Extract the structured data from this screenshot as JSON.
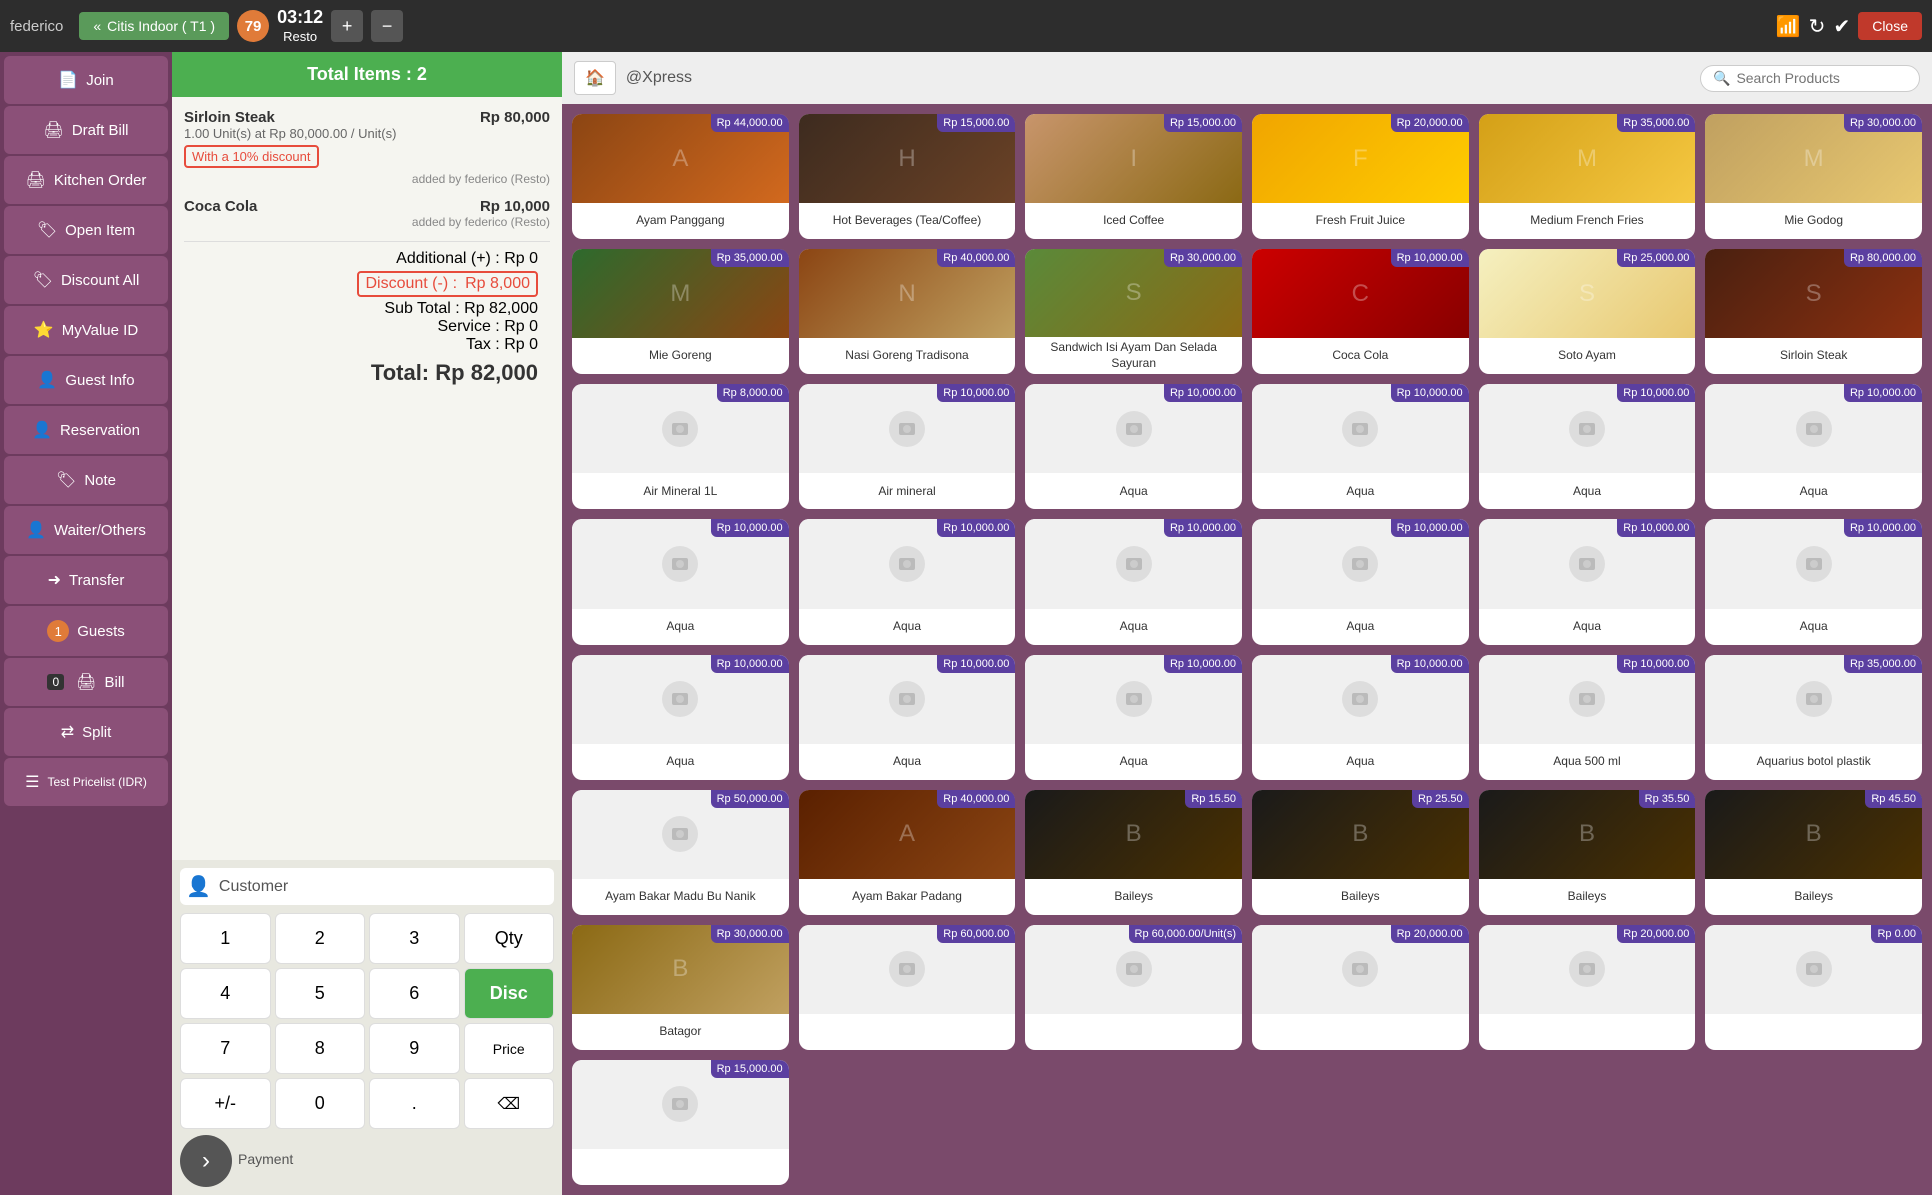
{
  "topbar": {
    "username": "federico",
    "venue": "Citis Indoor ( T1 )",
    "table_number": "79",
    "time": "03:12",
    "time_label": "Resto",
    "add_icon": "+",
    "minus_icon": "−",
    "close_label": "Close"
  },
  "sidebar": {
    "items": [
      {
        "id": "join",
        "label": "Join",
        "icon": "📄"
      },
      {
        "id": "draft-bill",
        "label": "Draft Bill",
        "icon": "🖨"
      },
      {
        "id": "kitchen-order",
        "label": "Kitchen Order",
        "icon": "🖨"
      },
      {
        "id": "open-item",
        "label": "Open Item",
        "icon": "🏷"
      },
      {
        "id": "discount-all",
        "label": "Discount All",
        "icon": "🏷"
      },
      {
        "id": "myvalue-id",
        "label": "MyValue ID",
        "icon": "⭐"
      },
      {
        "id": "guest-info",
        "label": "Guest Info",
        "icon": "👤"
      },
      {
        "id": "reservation",
        "label": "Reservation",
        "icon": "👤"
      },
      {
        "id": "note",
        "label": "Note",
        "icon": "🏷"
      },
      {
        "id": "waiter-others",
        "label": "Waiter/Others",
        "icon": "👤"
      },
      {
        "id": "transfer",
        "label": "Transfer",
        "icon": "➜"
      },
      {
        "id": "guests",
        "label": "Guests",
        "icon": "1"
      },
      {
        "id": "bill",
        "label": "Bill",
        "icon": "🖨",
        "badge": "0"
      },
      {
        "id": "split",
        "label": "Split",
        "icon": "🔀"
      },
      {
        "id": "test-pricelist",
        "label": "Test Pricelist\n(IDR)",
        "icon": "☰"
      }
    ]
  },
  "order": {
    "item1": {
      "name": "Sirloin Steak",
      "price": "Rp 80,000",
      "unit_detail": "1.00 Unit(s) at Rp 80,000.00 / Unit(s)",
      "discount_label": "With a 10% discount",
      "added_by": "added by federico (Resto)"
    },
    "item2": {
      "name": "Coca Cola",
      "price": "Rp 10,000",
      "added_by": "added by federico (Resto)"
    },
    "totals": {
      "additional_label": "Additional (+) :",
      "additional_value": "Rp 0",
      "discount_label": "Discount (-) :",
      "discount_value": "Rp 8,000",
      "subtotal_label": "Sub Total :",
      "subtotal_value": "Rp 82,000",
      "service_label": "Service :",
      "service_value": "Rp 0",
      "tax_label": "Tax :",
      "tax_value": "Rp 0",
      "total_label": "Total:",
      "total_value": "Rp 82,000"
    },
    "total_items_label": "Total Items : 2"
  },
  "numpad": {
    "customer_label": "Customer",
    "buttons": [
      "1",
      "2",
      "3",
      "4",
      "5",
      "6",
      "7",
      "8",
      "9",
      "+/-",
      "0",
      "."
    ],
    "qty_label": "Qty",
    "disc_label": "Disc",
    "price_label": "Price",
    "backspace": "⌫",
    "payment_label": "Payment"
  },
  "product_area": {
    "home_icon": "🏠",
    "xpress_label": "@Xpress",
    "search_placeholder": "Search Products",
    "products": [
      {
        "name": "Ayam Panggang",
        "price": "Rp 44,000.00",
        "img_class": "img-ayam"
      },
      {
        "name": "Hot Beverages (Tea/Coffee)",
        "price": "Rp 15,000.00",
        "img_class": "img-coffee"
      },
      {
        "name": "Iced Coffee",
        "price": "Rp 15,000.00",
        "img_class": "img-iced-coffee"
      },
      {
        "name": "Fresh Fruit Juice",
        "price": "Rp 20,000.00",
        "img_class": "img-juice"
      },
      {
        "name": "Medium French Fries",
        "price": "Rp 35,000.00",
        "img_class": "img-fries"
      },
      {
        "name": "Mie Godog",
        "price": "Rp 30,000.00",
        "img_class": "img-noodle"
      },
      {
        "name": "Mie Goreng",
        "price": "Rp 35,000.00",
        "img_class": "img-miegoreng"
      },
      {
        "name": "Nasi Goreng Tradisona",
        "price": "Rp 40,000.00",
        "img_class": "img-nasigoreng"
      },
      {
        "name": "Sandwich Isi Ayam Dan Selada Sayuran",
        "price": "Rp 30,000.00",
        "img_class": "img-sandwich"
      },
      {
        "name": "Coca Cola",
        "price": "Rp 10,000.00",
        "img_class": "img-coke"
      },
      {
        "name": "Soto Ayam",
        "price": "Rp 25,000.00",
        "img_class": "img-soto"
      },
      {
        "name": "Sirloin Steak",
        "price": "Rp 80,000.00",
        "img_class": "img-sirloin"
      },
      {
        "name": "Air Mineral 1L",
        "price": "Rp 8,000.00",
        "img_class": "img-air",
        "placeholder": true
      },
      {
        "name": "Air mineral",
        "price": "Rp 10,000.00",
        "img_class": "img-air",
        "placeholder": true
      },
      {
        "name": "Aqua",
        "price": "Rp 10,000.00",
        "img_class": "",
        "placeholder": true
      },
      {
        "name": "Aqua",
        "price": "Rp 10,000.00",
        "img_class": "",
        "placeholder": true
      },
      {
        "name": "Aqua",
        "price": "Rp 10,000.00",
        "img_class": "",
        "placeholder": true
      },
      {
        "name": "Aqua",
        "price": "Rp 10,000.00",
        "img_class": "",
        "placeholder": true
      },
      {
        "name": "Aqua",
        "price": "Rp 10,000.00",
        "img_class": "",
        "placeholder": true
      },
      {
        "name": "Aqua",
        "price": "Rp 10,000.00",
        "img_class": "",
        "placeholder": true
      },
      {
        "name": "Aqua",
        "price": "Rp 10,000.00",
        "img_class": "",
        "placeholder": true
      },
      {
        "name": "Aqua",
        "price": "Rp 10,000.00",
        "img_class": "",
        "placeholder": true
      },
      {
        "name": "Aqua",
        "price": "Rp 10,000.00",
        "img_class": "",
        "placeholder": true
      },
      {
        "name": "Aqua",
        "price": "Rp 10,000.00",
        "img_class": "",
        "placeholder": true
      },
      {
        "name": "Aqua",
        "price": "Rp 10,000.00",
        "img_class": "",
        "placeholder": true
      },
      {
        "name": "Aqua",
        "price": "Rp 10,000.00",
        "img_class": "",
        "placeholder": true
      },
      {
        "name": "Aqua",
        "price": "Rp 10,000.00",
        "img_class": "",
        "placeholder": true
      },
      {
        "name": "Aqua",
        "price": "Rp 10,000.00",
        "img_class": "",
        "placeholder": true
      },
      {
        "name": "Aqua 500 ml",
        "price": "Rp 10,000.00",
        "img_class": "",
        "placeholder": true
      },
      {
        "name": "Aquarius botol plastik",
        "price": "Rp 35,000.00",
        "img_class": "",
        "placeholder": true
      },
      {
        "name": "Ayam Bakar Madu Bu Nanik",
        "price": "Rp 50,000.00",
        "img_class": "",
        "placeholder": true
      },
      {
        "name": "Ayam Bakar Padang",
        "price": "Rp 40,000.00",
        "img_class": "img-ayambakarpadang"
      },
      {
        "name": "Baileys",
        "price": "Rp 15.50",
        "img_class": "img-baileys"
      },
      {
        "name": "Baileys",
        "price": "Rp 25.50",
        "img_class": "img-baileys"
      },
      {
        "name": "Baileys",
        "price": "Rp 35.50",
        "img_class": "img-baileys"
      },
      {
        "name": "Baileys",
        "price": "Rp 45.50",
        "img_class": "img-baileys"
      },
      {
        "name": "Batagor",
        "price": "Rp 30,000.00",
        "img_class": "img-batagor"
      },
      {
        "name": "",
        "price": "Rp 60,000.00",
        "img_class": "",
        "placeholder": true
      },
      {
        "name": "",
        "price": "Rp 60,000.00/Unit(s)",
        "img_class": "",
        "placeholder": true
      },
      {
        "name": "",
        "price": "Rp 20,000.00",
        "img_class": "",
        "placeholder": true
      },
      {
        "name": "",
        "price": "Rp 20,000.00",
        "img_class": "",
        "placeholder": true
      },
      {
        "name": "",
        "price": "Rp 0.00",
        "img_class": "",
        "placeholder": true
      },
      {
        "name": "",
        "price": "Rp 15,000.00",
        "img_class": "",
        "placeholder": true
      }
    ]
  }
}
